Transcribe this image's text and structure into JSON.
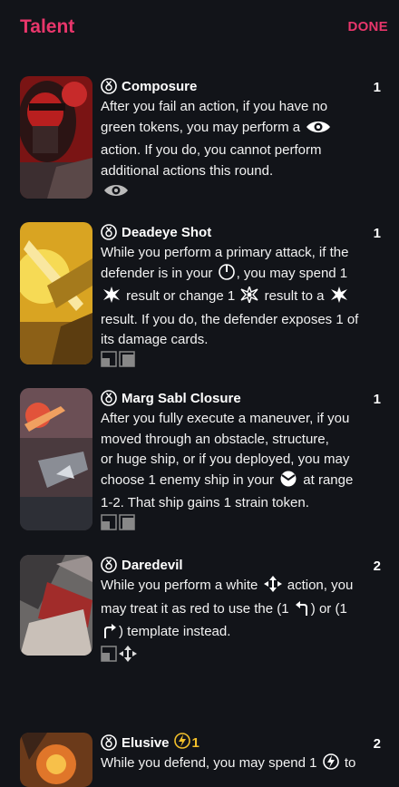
{
  "header": {
    "title": "Talent",
    "done_label": "DONE"
  },
  "cards": [
    {
      "name": "Composure",
      "cost": "1",
      "text": [
        "After you fail an action, if you have no",
        "green tokens, you may perform a",
        "action. If you do, you cannot perform",
        "additional actions this round."
      ],
      "action_icon": "eye-icon"
    },
    {
      "name": "Deadeye Shot",
      "cost": "1",
      "text": [
        "While you perform a primary attack, if the",
        "defender is in your",
        ", you may spend 1",
        "result or change 1",
        "result to a",
        "result. If you do, the defender exposes 1 of",
        "its damage cards."
      ],
      "slot_icons": [
        "talent-slot-icon",
        "talent-slot-icon"
      ]
    },
    {
      "name": "Marg Sabl Closure",
      "cost": "1",
      "text": [
        "After you fully execute a maneuver, if you",
        "moved through an obstacle, structure,",
        "or huge ship, or if you deployed, you may",
        "choose 1 enemy ship in your",
        "at range",
        "1-2. That ship gains 1 strain token."
      ],
      "slot_icons": [
        "talent-slot-icon",
        "talent-slot-icon"
      ]
    },
    {
      "name": "Daredevil",
      "cost": "2",
      "text": [
        "While you perform a white",
        "action, you",
        "may treat it as red to use the (1",
        ") or (1",
        ") template instead."
      ],
      "slot_icons": [
        "talent-slot-icon",
        "boost-icon"
      ]
    },
    {
      "name": "Elusive",
      "cost": "2",
      "charge": "1",
      "text": [
        "While you defend, you may spend 1",
        "to"
      ]
    }
  ],
  "colors": {
    "accent": "#e8366b",
    "background": "#121419",
    "charge": "#f3c02b"
  }
}
